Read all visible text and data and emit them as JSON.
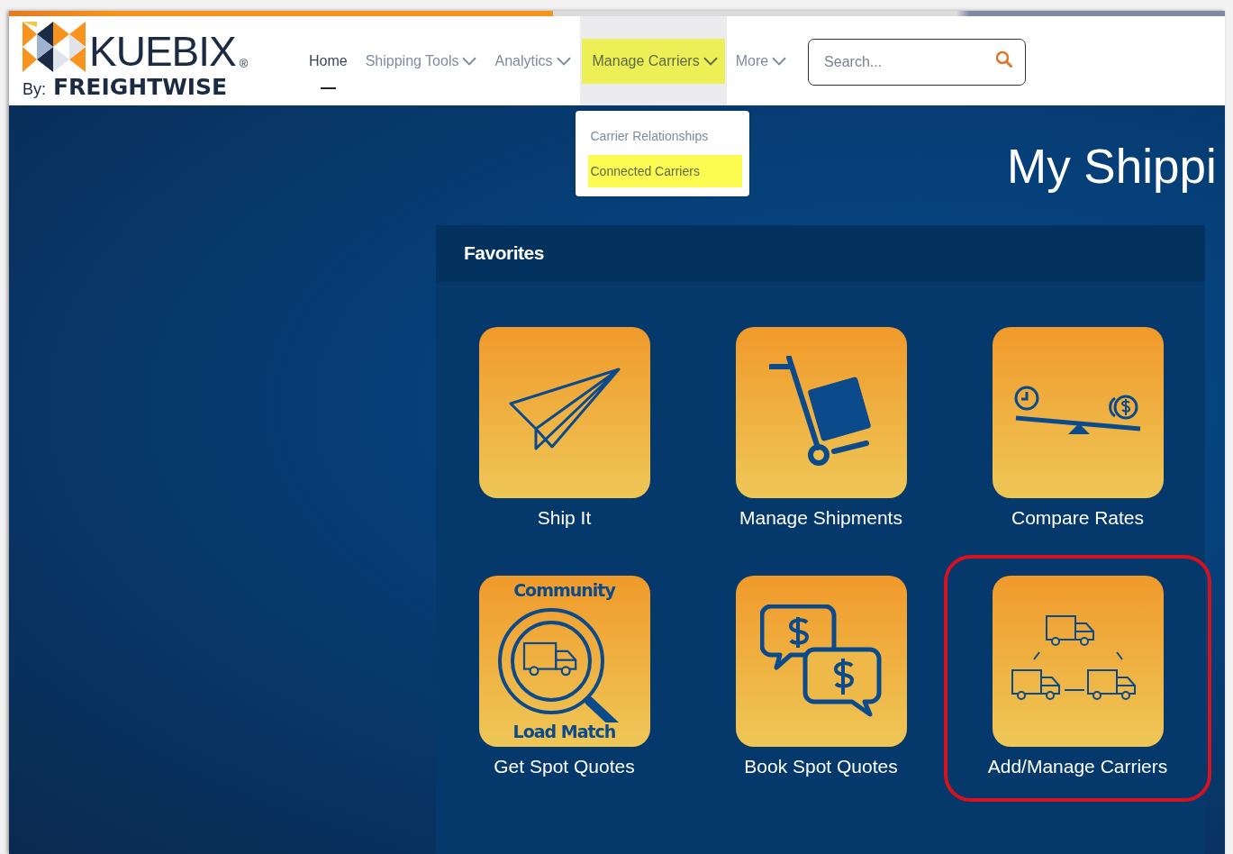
{
  "logo": {
    "name": "KUEBIX",
    "mark": "®",
    "by": "By:",
    "brand": "FREIGHTWISE"
  },
  "nav": [
    {
      "label": "Home",
      "selected": true,
      "dropdown": false,
      "open": false,
      "highlighted": false
    },
    {
      "label": "Shipping Tools",
      "selected": false,
      "dropdown": true,
      "open": false,
      "highlighted": false
    },
    {
      "label": "Analytics",
      "selected": false,
      "dropdown": true,
      "open": false,
      "highlighted": false
    },
    {
      "label": "Manage Carriers",
      "selected": false,
      "dropdown": true,
      "open": true,
      "highlighted": true,
      "menu": [
        {
          "label": "Carrier Relationships",
          "highlighted": false
        },
        {
          "label": "Connected Carriers",
          "highlighted": true
        }
      ]
    },
    {
      "label": "More",
      "selected": false,
      "dropdown": true,
      "open": false,
      "highlighted": false
    }
  ],
  "search": {
    "placeholder": "Search..."
  },
  "page_title": "My Shippi",
  "favorites": {
    "title": "Favorites",
    "tiles": [
      {
        "label": "Ship It",
        "kind": "plane",
        "highlighted": false
      },
      {
        "label": "Manage Shipments",
        "kind": "dolly",
        "highlighted": false
      },
      {
        "label": "Compare Rates",
        "kind": "scale",
        "highlighted": false
      },
      {
        "label": "Get Spot Quotes",
        "kind": "loadmatch",
        "icon_texts": [
          "Community",
          "Load Match"
        ],
        "highlighted": false
      },
      {
        "label": "Book Spot Quotes",
        "kind": "bubbles",
        "highlighted": false
      },
      {
        "label": "Add/Manage Carriers",
        "kind": "trucks",
        "highlighted": true
      }
    ]
  }
}
